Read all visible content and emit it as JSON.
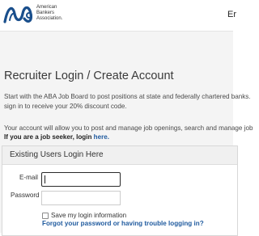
{
  "header": {
    "logo_lines": [
      "American",
      "Bankers",
      "Association."
    ],
    "right_cut_text": "Er"
  },
  "page": {
    "title": "Recruiter Login / Create Account",
    "intro_lines": [
      "Start with the ABA Job Board to post positions at state and federally chartered banks.",
      "sign in to receive your 20% discount code."
    ],
    "account_line": "Your account will allow you to post and manage job openings, search and manage job",
    "seeker_prefix": "If you are a job seeker, login ",
    "seeker_link": "here."
  },
  "login_panel": {
    "heading": "Existing Users Login Here",
    "email_label": "E-mail",
    "email_value": "",
    "password_label": "Password",
    "remember_label": "Save my login information",
    "remember_checked": false,
    "forgot_link": "Forgot your password or having trouble logging in?"
  },
  "colors": {
    "brand_blue": "#1a4f8c",
    "link_blue": "#1f5a9e",
    "band_gray": "#f4f4f4"
  }
}
